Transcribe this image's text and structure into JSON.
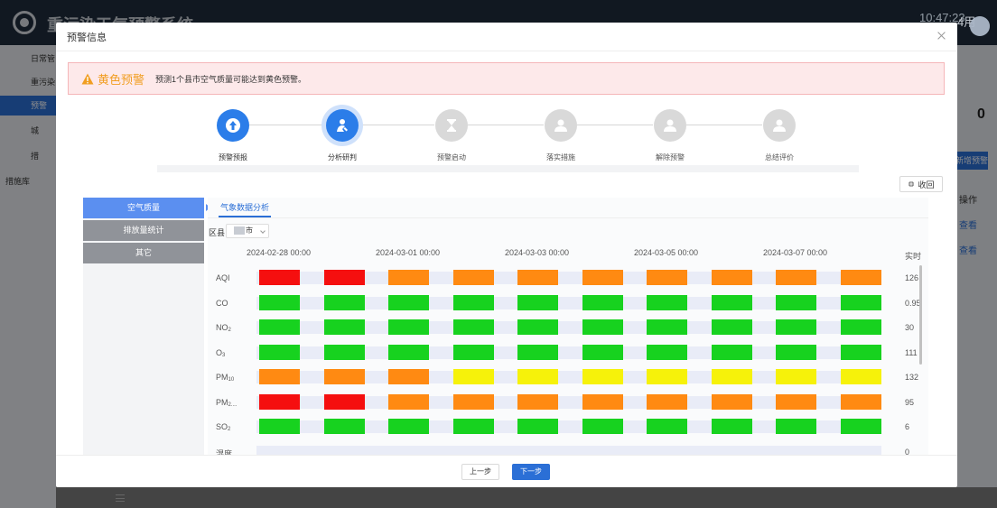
{
  "background": {
    "app_title": "重污染天气预警系统",
    "time": "10:47:23",
    "user": "4用",
    "sidebar": [
      "日常管",
      "重污染",
      "预警",
      "城",
      "措",
      "措施库"
    ],
    "right_count": "0",
    "right_button": "新增预警",
    "right_column": "操作",
    "right_links": [
      "查看",
      "查看"
    ]
  },
  "modal": {
    "title": "预警信息",
    "alert": {
      "level": "黄色预警",
      "message": "预测1个县市空气质量可能达到黄色预警。",
      "color": "#f19e22"
    },
    "steps": [
      {
        "label": "预警预报",
        "state": "done"
      },
      {
        "label": "分析研判",
        "state": "current"
      },
      {
        "label": "预警启动",
        "state": "todo"
      },
      {
        "label": "落实措施",
        "state": "todo"
      },
      {
        "label": "解除预警",
        "state": "todo"
      },
      {
        "label": "总结评价",
        "state": "todo"
      }
    ],
    "collapse_label": "收回",
    "left_menu": [
      {
        "label": "空气质量",
        "active": true
      },
      {
        "label": "排放量统计",
        "active": false
      },
      {
        "label": "其它",
        "active": false
      }
    ],
    "subtab": "气象数据分析",
    "region": {
      "label": "区县",
      "value": "市"
    },
    "dates": [
      "2024-02-28 00:00",
      "2024-03-01 00:00",
      "2024-03-03 00:00",
      "2024-03-05 00:00",
      "2024-03-07 00:00"
    ],
    "realtime_header": "实时",
    "colors": {
      "red": "#f50f0f",
      "orange": "#ff8a12",
      "green": "#17d21f",
      "yellow": "#f6f20a",
      "band": "#e9ecf7"
    },
    "rows": [
      {
        "label": "AQI",
        "sub": "",
        "realtime": "126",
        "cells": [
          "red",
          "red",
          "orange",
          "orange",
          "orange",
          "orange",
          "orange",
          "orange",
          "orange",
          "orange"
        ]
      },
      {
        "label": "CO",
        "sub": "",
        "realtime": "0.95",
        "cells": [
          "green",
          "green",
          "green",
          "green",
          "green",
          "green",
          "green",
          "green",
          "green",
          "green"
        ]
      },
      {
        "label": "NO",
        "sub": "2",
        "realtime": "30",
        "cells": [
          "green",
          "green",
          "green",
          "green",
          "green",
          "green",
          "green",
          "green",
          "green",
          "green"
        ]
      },
      {
        "label": "O",
        "sub": "3",
        "realtime": "111",
        "cells": [
          "green",
          "green",
          "green",
          "green",
          "green",
          "green",
          "green",
          "green",
          "green",
          "green"
        ]
      },
      {
        "label": "PM",
        "sub": "10",
        "realtime": "132",
        "cells": [
          "orange",
          "orange",
          "orange",
          "yellow",
          "yellow",
          "yellow",
          "yellow",
          "yellow",
          "yellow",
          "yellow"
        ]
      },
      {
        "label": "PM",
        "sub": "2....",
        "realtime": "95",
        "cells": [
          "red",
          "red",
          "orange",
          "orange",
          "orange",
          "orange",
          "orange",
          "orange",
          "orange",
          "orange"
        ]
      },
      {
        "label": "SO",
        "sub": "2",
        "realtime": "6",
        "cells": [
          "green",
          "green",
          "green",
          "green",
          "green",
          "green",
          "green",
          "green",
          "green",
          "green"
        ]
      },
      {
        "label": "湿度",
        "sub": "",
        "realtime": "0",
        "cells": [
          "none",
          "none",
          "none",
          "none",
          "none",
          "none",
          "none",
          "none",
          "none",
          "none"
        ]
      }
    ],
    "buttons": {
      "prev": "上一步",
      "next": "下一步"
    }
  }
}
